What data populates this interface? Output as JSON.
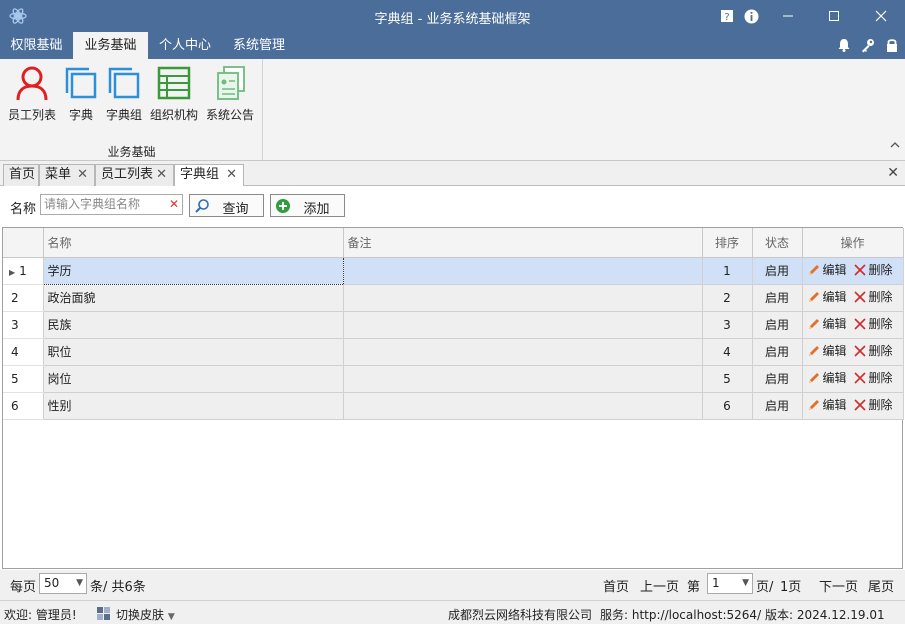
{
  "window": {
    "title": "字典组 - 业务系统基础框架"
  },
  "ribbon_tabs": [
    "权限基础",
    "业务基础",
    "个人中心",
    "系统管理"
  ],
  "ribbon": {
    "buttons": [
      "员工列表",
      "字典",
      "字典组",
      "组织机构",
      "系统公告"
    ],
    "group_label": "业务基础"
  },
  "doc_tabs": [
    "首页",
    "菜单",
    "员工列表",
    "字典组"
  ],
  "search": {
    "label": "名称",
    "placeholder": "请输入字典组名称",
    "query_button": "查询",
    "add_button": "添加"
  },
  "grid": {
    "columns": [
      "名称",
      "备注",
      "排序",
      "状态",
      "操作"
    ],
    "rows": [
      {
        "no": "1",
        "name": "学历",
        "remark": "",
        "order": "1",
        "status": "启用"
      },
      {
        "no": "2",
        "name": "政治面貌",
        "remark": "",
        "order": "2",
        "status": "启用"
      },
      {
        "no": "3",
        "name": "民族",
        "remark": "",
        "order": "3",
        "status": "启用"
      },
      {
        "no": "4",
        "name": "职位",
        "remark": "",
        "order": "4",
        "status": "启用"
      },
      {
        "no": "5",
        "name": "岗位",
        "remark": "",
        "order": "5",
        "status": "启用"
      },
      {
        "no": "6",
        "name": "性别",
        "remark": "",
        "order": "6",
        "status": "启用"
      }
    ],
    "edit_label": "编辑",
    "delete_label": "删除"
  },
  "pager": {
    "per_page_label": "每页",
    "page_size": "50",
    "total_text": "条/ 共6条",
    "first": "首页",
    "prev": "上一页",
    "page_prefix": "第",
    "current_page": "1",
    "page_suffix": "页/",
    "total_pages": "1页",
    "next": "下一页",
    "last": "尾页"
  },
  "statusbar": {
    "welcome": "欢迎: 管理员!",
    "skin": "切换皮肤",
    "company": "成都烈云网络科技有限公司",
    "service": "服务: http://localhost:5264/",
    "version": "版本: 2024.12.19.01"
  },
  "colors": {
    "titlebar": "#4a6d99",
    "selected_row": "#cfe0f7",
    "edit_icon": "#e0702a",
    "delete_icon": "#d42a2a",
    "employee_icon": "#e02020",
    "dict_icon": "#2d8fd8",
    "org_icon": "#3a9a3a"
  }
}
